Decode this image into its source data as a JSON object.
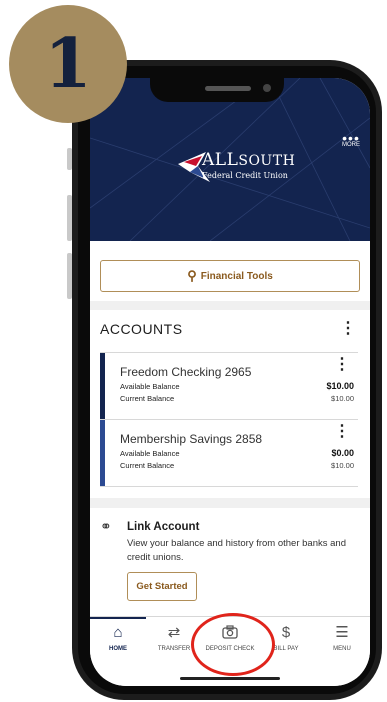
{
  "step": {
    "number": "1"
  },
  "header": {
    "more_label": "MORE",
    "logo": {
      "name_part1": "ALL",
      "name_part2": "SOUTH",
      "subtitle": "Federal Credit Union"
    }
  },
  "financial_tools": {
    "label": "Financial Tools"
  },
  "accounts": {
    "title": "ACCOUNTS",
    "items": [
      {
        "name": "Freedom Checking 2965",
        "available_label": "Available Balance",
        "current_label": "Current Balance",
        "available_value": "$10.00",
        "current_value": "$10.00",
        "accent": "#13244f"
      },
      {
        "name": "Membership Savings 2858",
        "available_label": "Available Balance",
        "current_label": "Current Balance",
        "available_value": "$0.00",
        "current_value": "$10.00",
        "accent": "#2c4a92"
      }
    ]
  },
  "link_account": {
    "title": "Link Account",
    "description": "View your balance and history from other banks and credit unions.",
    "button_label": "Get Started"
  },
  "nav": {
    "items": [
      {
        "label": "HOME",
        "icon": "home-icon",
        "active": true
      },
      {
        "label": "TRANSFER",
        "icon": "transfer-icon"
      },
      {
        "label": "DEPOSIT CHECK",
        "icon": "camera-icon"
      },
      {
        "label": "BILL PAY",
        "icon": "dollar-icon"
      },
      {
        "label": "MENU",
        "icon": "menu-list-icon"
      }
    ]
  },
  "colors": {
    "brand_navy": "#13244f",
    "gold": "#a58c5f",
    "highlight_red": "#e0241b"
  }
}
